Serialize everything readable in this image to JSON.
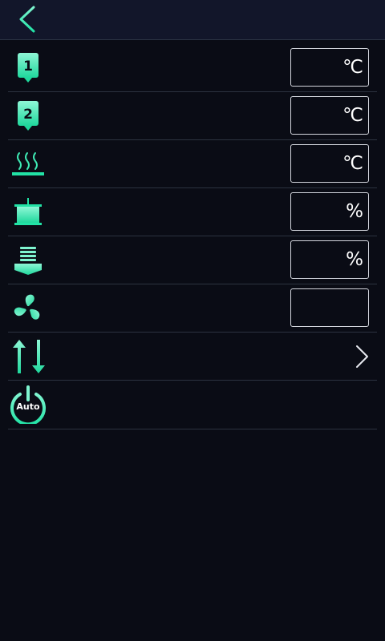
{
  "header": {
    "back_icon": "chevron-left-icon"
  },
  "colors": {
    "accent": "#22e3a6",
    "accent_light": "#7ff5d0",
    "background": "#0a0c15",
    "header_bg": "#12162a"
  },
  "rows": [
    {
      "name": "nozzle-1-temperature",
      "icon": "nozzle-1-icon",
      "badge": "1",
      "unit": "℃"
    },
    {
      "name": "nozzle-2-temperature",
      "icon": "nozzle-2-icon",
      "badge": "2",
      "unit": "℃"
    },
    {
      "name": "heated-bed-temperature",
      "icon": "heated-bed-icon",
      "unit": "℃"
    },
    {
      "name": "print-speed",
      "icon": "print-speed-icon",
      "unit": "%"
    },
    {
      "name": "flow-rate",
      "icon": "flow-rate-icon",
      "unit": "%"
    },
    {
      "name": "fan-speed",
      "icon": "fan-icon",
      "unit": ""
    },
    {
      "name": "feed-retract",
      "icon": "up-down-arrows-icon"
    },
    {
      "name": "auto-power-off",
      "icon": "auto-power-icon",
      "label": "Auto"
    }
  ]
}
